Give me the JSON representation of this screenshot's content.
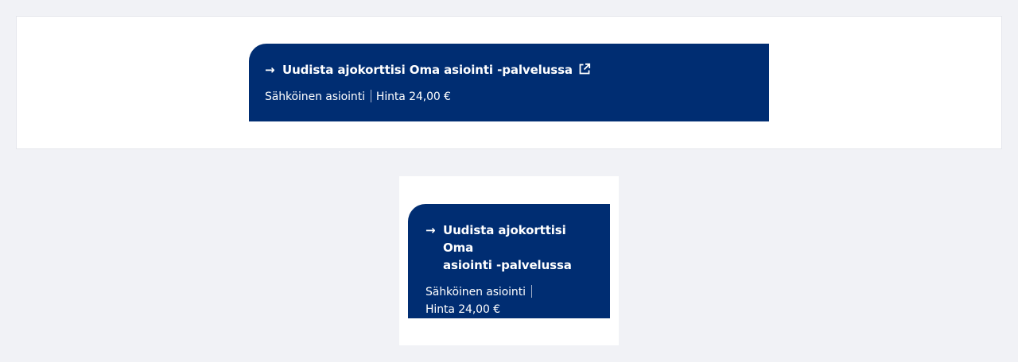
{
  "links": [
    {
      "arrow": "→",
      "title": "Uudista ajokorttisi Oma asiointi -palvelussa",
      "type": "Sähköinen asiointi",
      "price": "Hinta 24,00 €",
      "icon": "external-link-icon"
    },
    {
      "arrow": "→",
      "title_line1": "Uudista ajokorttisi Oma",
      "title_line2": "asiointi -palvelussa",
      "type": "Sähköinen asiointi",
      "price": "Hinta 24,00 €"
    }
  ],
  "colors": {
    "page_background": "#f1f2f6",
    "panel_background": "#ffffff",
    "button_background": "#002d72",
    "button_text": "#ffffff"
  }
}
